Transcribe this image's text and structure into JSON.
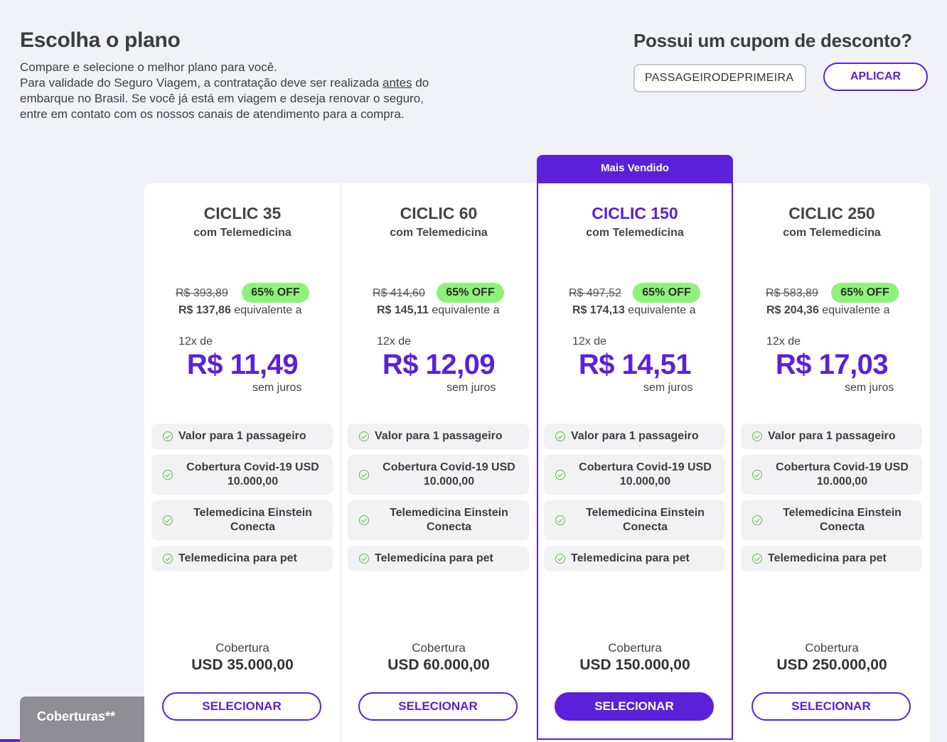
{
  "header": {
    "title": "Escolha o plano",
    "intro_line1": "Compare e selecione o melhor plano para você.",
    "intro_line2_before": "Para validade do Seguro Viagem, a contratação deve ser realizada ",
    "intro_line2_underlined": "antes",
    "intro_line2_after": " do",
    "intro_line3": "embarque no Brasil. Se você já está em viagem e deseja renovar o seguro,",
    "intro_line4": "entre em contato com os nossos canais de atendimento para a compra."
  },
  "coupon": {
    "title": "Possui um cupom de desconto?",
    "value": "PASSAGEIRODEPRIMEIRA",
    "apply_label": "APLICAR"
  },
  "featured_badge": "Mais Vendido",
  "plans": [
    {
      "name": "CICLIC 35",
      "subtitle": "com Telemedicina",
      "old_price": "R$ 393,89",
      "discount": "65% OFF",
      "total_price": "R$ 137,86",
      "total_suffix": " equivalente a",
      "installments_prefix": "12x de",
      "installment_value": "R$ 11,49",
      "installments_suffix": "sem juros",
      "features": [
        "Valor para 1 passageiro",
        "Cobertura Covid-19 USD 10.000,00",
        "Telemedicina Einstein Conecta",
        "Telemedicina para pet"
      ],
      "coverage_label": "Cobertura",
      "coverage_value": "USD 35.000,00",
      "select_label": "SELECIONAR"
    },
    {
      "name": "CICLIC 60",
      "subtitle": "com Telemedicina",
      "old_price": "R$ 414,60",
      "discount": "65% OFF",
      "total_price": "R$ 145,11",
      "total_suffix": " equivalente a",
      "installments_prefix": "12x de",
      "installment_value": "R$ 12,09",
      "installments_suffix": "sem juros",
      "features": [
        "Valor para 1 passageiro",
        "Cobertura Covid-19 USD 10.000,00",
        "Telemedicina Einstein Conecta",
        "Telemedicina para pet"
      ],
      "coverage_label": "Cobertura",
      "coverage_value": "USD 60.000,00",
      "select_label": "SELECIONAR"
    },
    {
      "name": "CICLIC 150",
      "subtitle": "com Telemedicina",
      "old_price": "R$ 497,52",
      "discount": "65% OFF",
      "total_price": "R$ 174,13",
      "total_suffix": " equivalente a",
      "installments_prefix": "12x de",
      "installment_value": "R$ 14,51",
      "installments_suffix": "sem juros",
      "features": [
        "Valor para 1 passageiro",
        "Cobertura Covid-19 USD 10.000,00",
        "Telemedicina Einstein Conecta",
        "Telemedicina para pet"
      ],
      "coverage_label": "Cobertura",
      "coverage_value": "USD 150.000,00",
      "select_label": "SELECIONAR"
    },
    {
      "name": "CICLIC 250",
      "subtitle": "com Telemedicina",
      "old_price": "R$ 583,89",
      "discount": "65% OFF",
      "total_price": "R$ 204,36",
      "total_suffix": " equivalente a",
      "installments_prefix": "12x de",
      "installment_value": "R$ 17,03",
      "installments_suffix": "sem juros",
      "features": [
        "Valor para 1 passageiro",
        "Cobertura Covid-19 USD 10.000,00",
        "Telemedicina Einstein Conecta",
        "Telemedicina para pet"
      ],
      "coverage_label": "Cobertura",
      "coverage_value": "USD 250.000,00",
      "select_label": "SELECIONAR"
    }
  ],
  "coverage_tab": "Coberturas**",
  "colors": {
    "accent": "#5b21d8",
    "discount_badge": "#8ef27a",
    "check": "#5ec24a",
    "background": "#f1f2f8"
  },
  "icons": {
    "feature_check": "check-circle-icon"
  }
}
